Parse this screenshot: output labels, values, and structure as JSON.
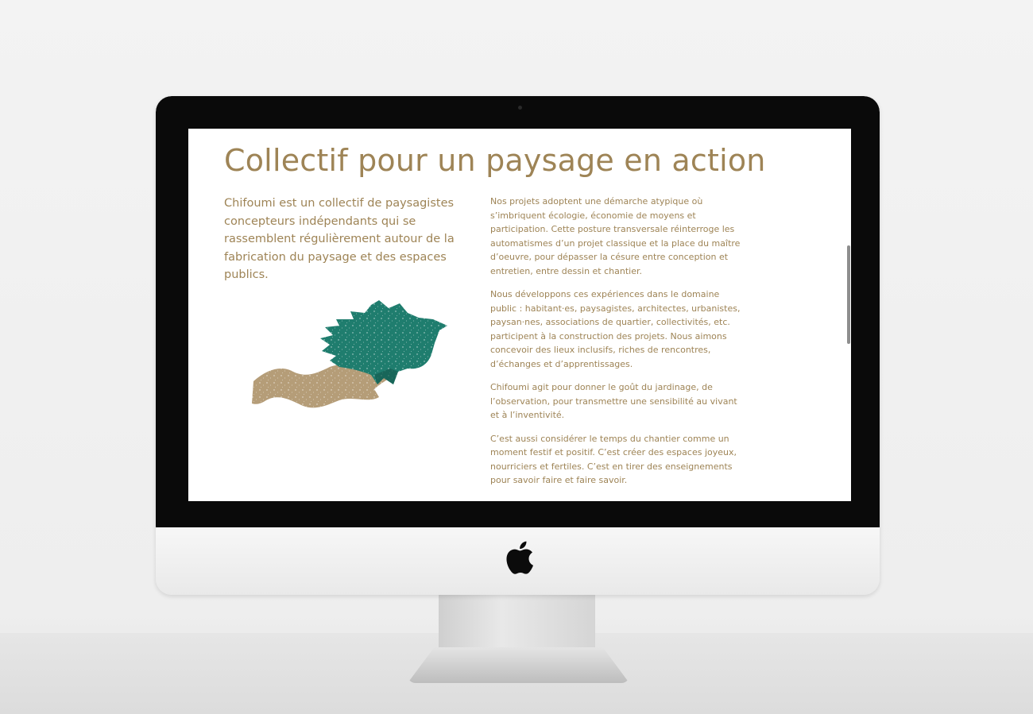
{
  "page": {
    "title": "Collectif pour un paysage en action",
    "intro": "Chifoumi est un collectif de paysagistes concepteurs indépendants qui se rassemblent régulièrement autour de la fabrication du paysage et des espaces publics.",
    "paragraphs": [
      "Nos projets adoptent une démarche atypique où s’imbriquent écologie, économie de moyens et participation. Cette posture transversale réinterroge les automatismes d’un projet classique et la place du maître d’oeuvre, pour dépasser la césure entre conception et entretien, entre dessin et chantier.",
      "Nous développons ces expériences dans le domaine public : habitant·es, paysagistes, architectes, urbanistes, paysan·nes, associations de quartier, collectivités, etc. participent à la construction des projets. Nous aimons concevoir des lieux inclusifs, riches de rencontres, d’échanges et d’apprentissages.",
      "Chifoumi agit pour donner le goût du jardinage, de l’observation, pour transmettre une sensibilité au vivant et à l’inventivité.",
      "C’est aussi considérer le temps du chantier comme un moment festif et positif. C’est créer des espaces joyeux, nourriciers et fertiles. C’est en tirer des enseignements pour savoir faire et faire savoir."
    ]
  },
  "colors": {
    "text": "#9e8456",
    "bird": "#1f7d6e",
    "hand": "#b59d78",
    "bezel": "#0a0a0a"
  },
  "icons": {
    "logo": "apple-logo-icon",
    "illustration": "bird-hand-illustration"
  }
}
